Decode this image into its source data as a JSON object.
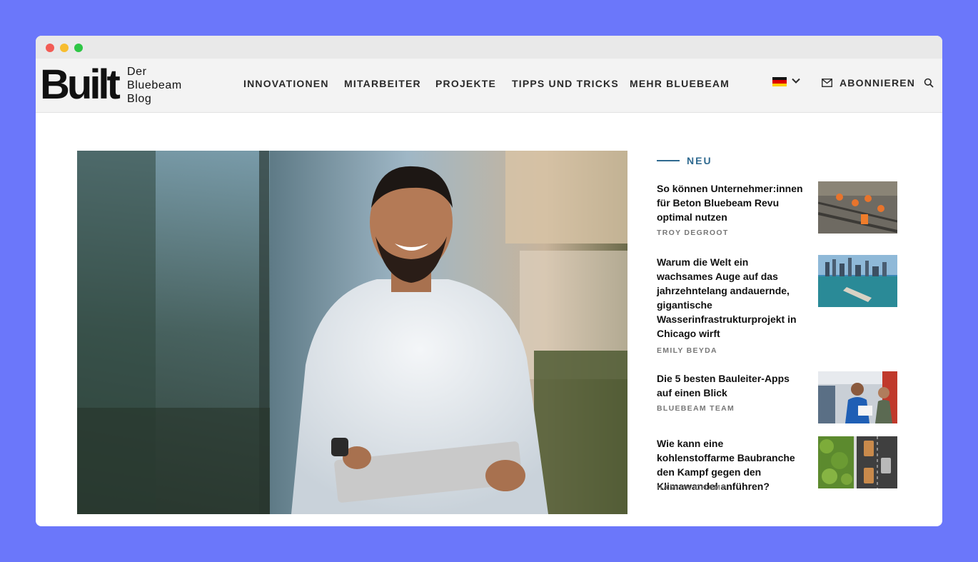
{
  "logo": {
    "word": "Built",
    "sub_lines": [
      "Der",
      "Bluebeam",
      "Blog"
    ]
  },
  "nav": {
    "items": [
      "INNOVATIONEN",
      "MITARBEITER",
      "PROJEKTE",
      "TIPPS UND TRICKS",
      "MEHR BLUEBEAM"
    ],
    "language_flag": "germany-flag-icon",
    "subscribe_label": "ABONNIEREN"
  },
  "colors": {
    "background": "#6b77fa",
    "accent": "#2f6a90",
    "navbar": "#f3f3f3"
  },
  "sidebar": {
    "section_label": "NEU",
    "articles": [
      {
        "title": "So können Unternehmer:innen für Beton Bluebeam Revu optimal nutzen",
        "author": "TROY DEGROOT"
      },
      {
        "title": "Warum die Welt ein wachsames Auge auf das jahrzehntelang andauernde, gigantische Wasserinfrastrukturprojekt in Chicago wirft",
        "author": "EMILY BEYDA"
      },
      {
        "title": "Die 5 besten Bauleiter-Apps auf einen Blick",
        "author": "BLUEBEAM TEAM"
      },
      {
        "title": "Wie kann eine kohlenstoffarme Baubranche den Kampf gegen den Klimawandel anführen?",
        "author": "HAMISH CHAMP"
      }
    ]
  }
}
